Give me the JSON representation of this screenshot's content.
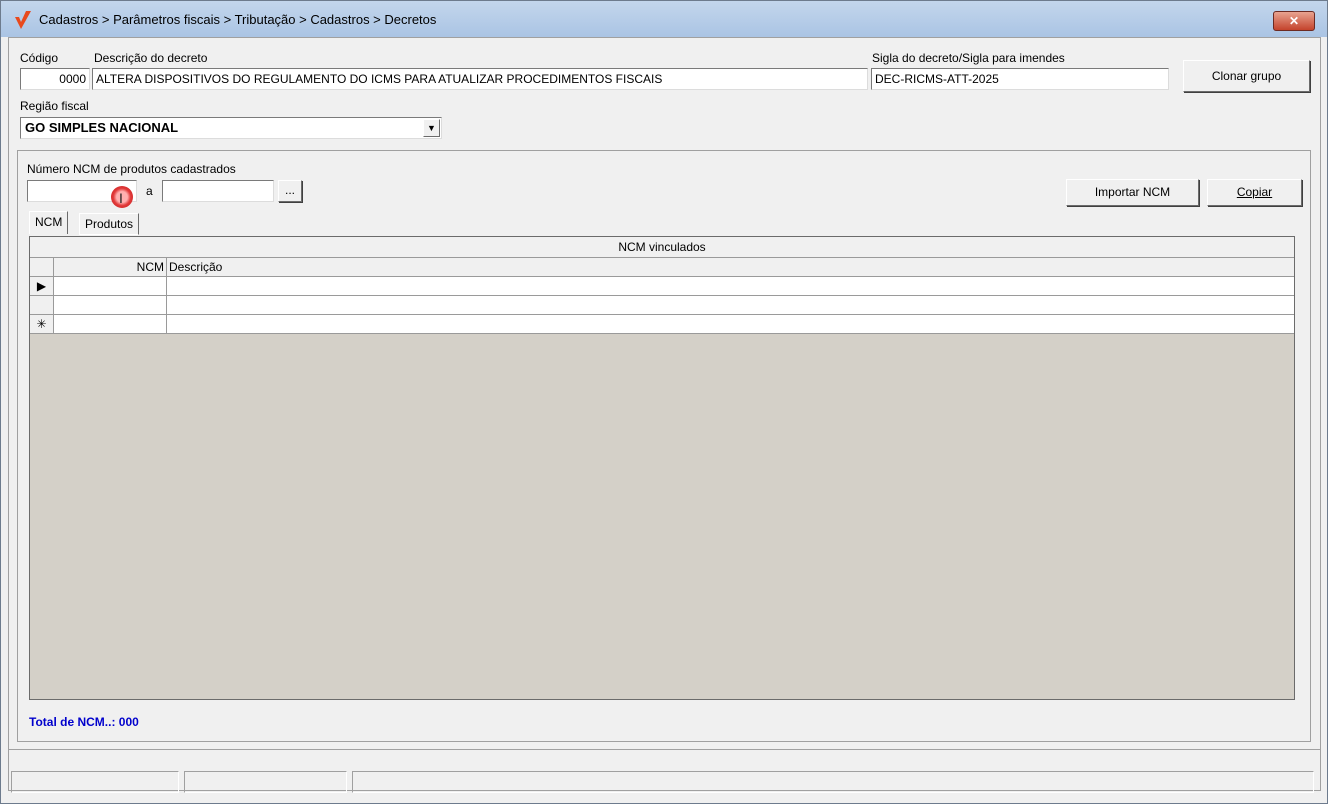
{
  "window": {
    "title": "Cadastros > Parâmetros fiscais > Tributação > Cadastros > Decretos",
    "close_label": "✕"
  },
  "form": {
    "codigo_label": "Código",
    "codigo_value": "0000",
    "descricao_label": "Descrição do decreto",
    "descricao_value": "ALTERA DISPOSITIVOS DO REGULAMENTO DO ICMS PARA ATUALIZAR PROCEDIMENTOS FISCAIS",
    "sigla_label": "Sigla do decreto/Sigla para imendes",
    "sigla_value": "DEC-RICMS-ATT-2025",
    "clonar_label": "Clonar grupo",
    "regiao_label": "Região fiscal",
    "regiao_value": "GO SIMPLES NACIONAL"
  },
  "ncm_filter": {
    "label": "Número  NCM de produtos cadastrados",
    "from_value": "",
    "range_sep": "a",
    "to_value": "",
    "browse_label": "...",
    "importar_label": "Importar NCM",
    "copiar_label": "Copiar"
  },
  "tabs": [
    {
      "label": "NCM",
      "active": true
    },
    {
      "label": "Produtos",
      "active": false
    }
  ],
  "grid": {
    "caption": "NCM vinculados",
    "columns": [
      "NCM",
      "Descrição"
    ],
    "row_markers": [
      "current-row-arrow",
      "",
      "new-row-asterisk"
    ]
  },
  "footer": {
    "total_text": "Total de NCM..: 000"
  },
  "colors": {
    "total_text": "#0000cc",
    "grid_empty_area": "#d4d0c8",
    "titlebar": "#b8cfea"
  }
}
